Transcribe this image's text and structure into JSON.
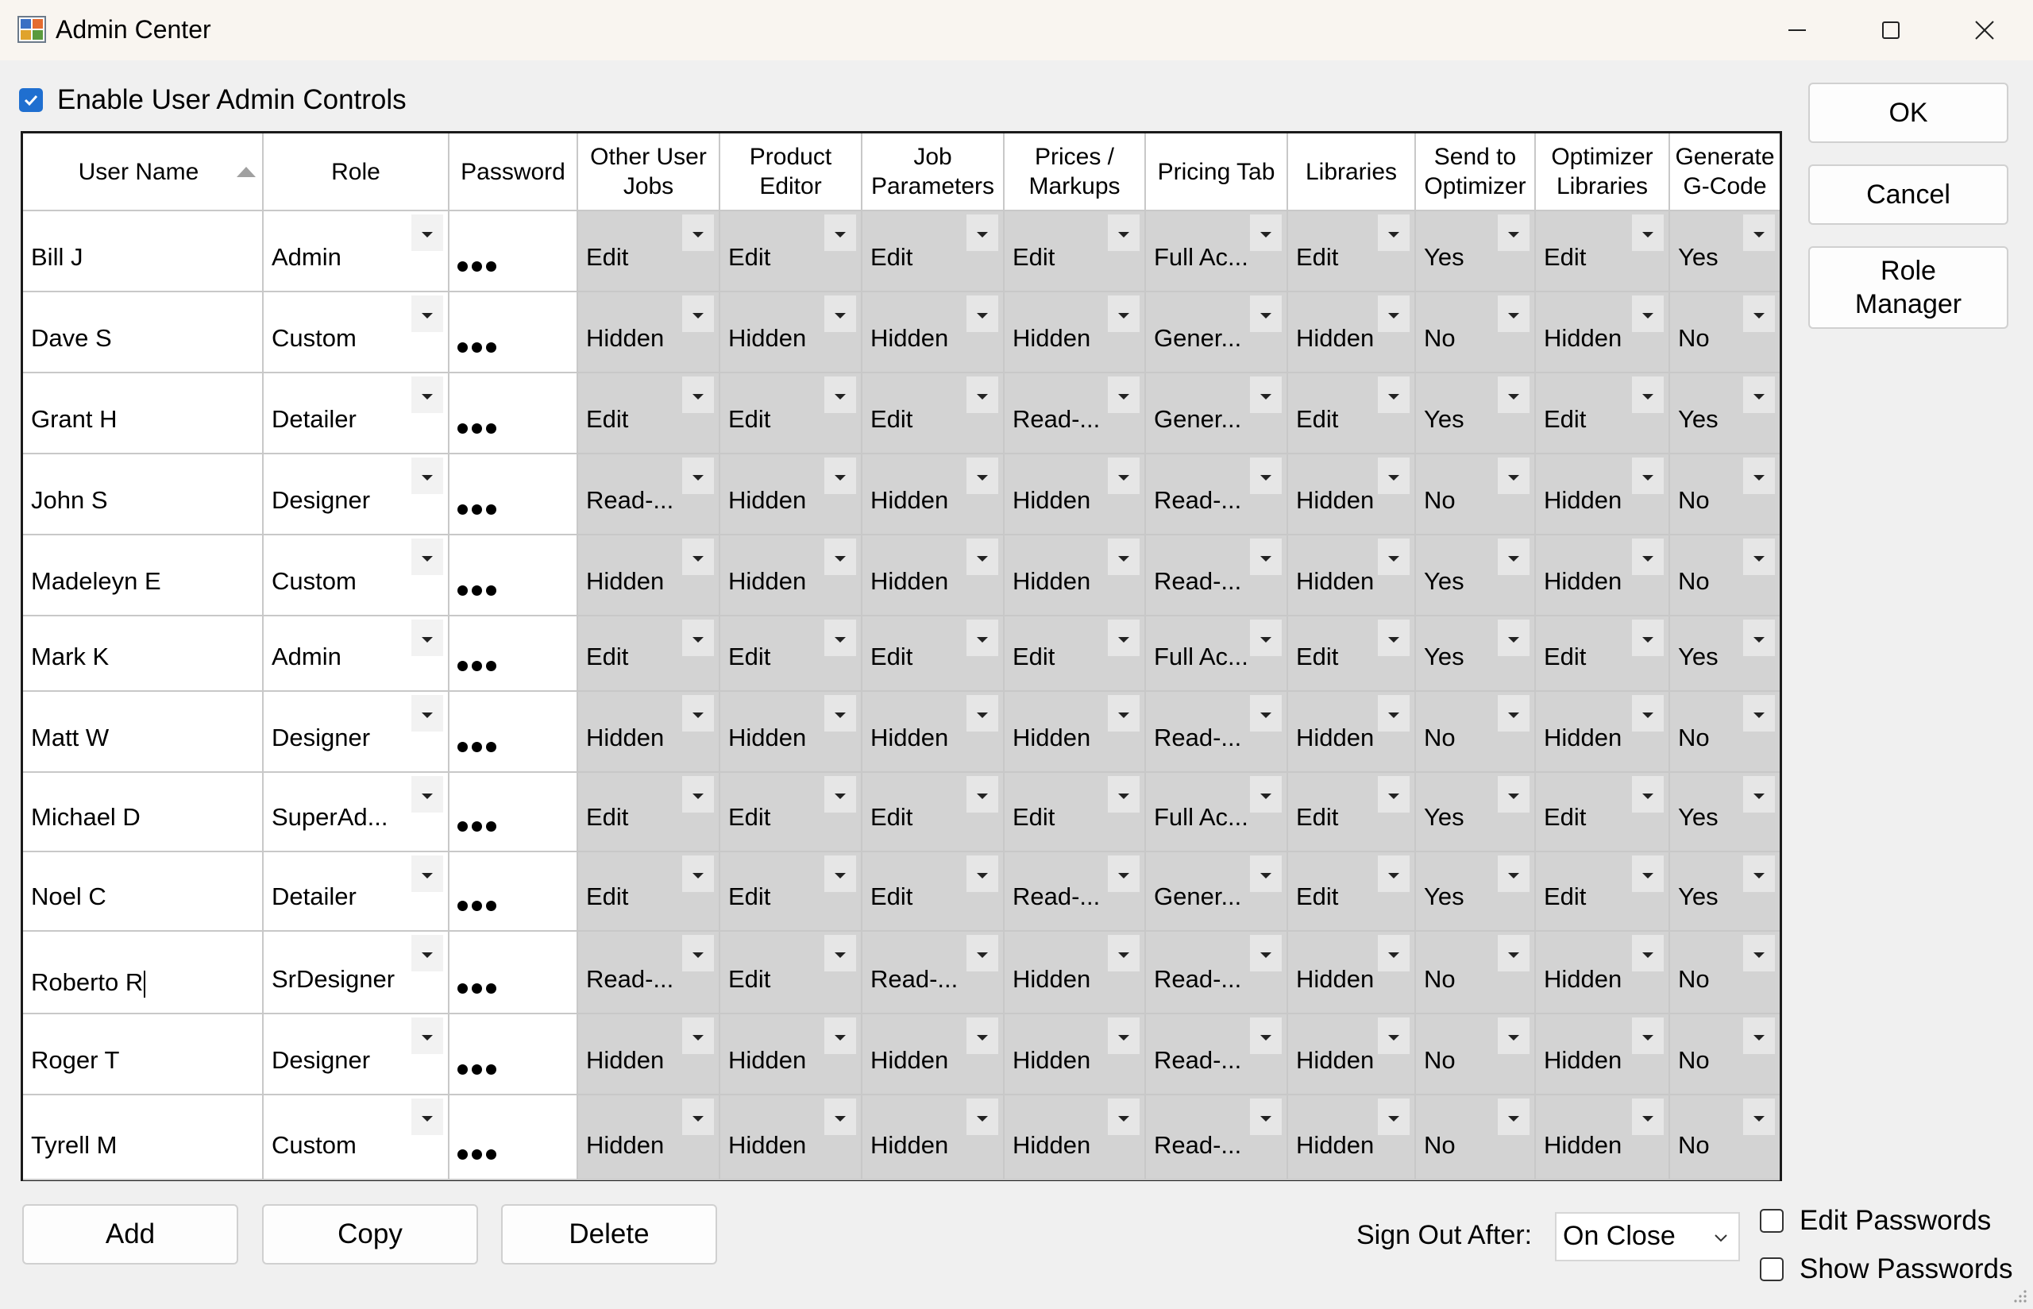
{
  "window": {
    "title": "Admin Center"
  },
  "enable_controls": {
    "label": "Enable User Admin Controls",
    "checked": true
  },
  "grid": {
    "columns": [
      {
        "key": "user",
        "label": "User Name",
        "sort": "ascending"
      },
      {
        "key": "role",
        "label": "Role"
      },
      {
        "key": "password",
        "label": "Password"
      },
      {
        "key": "other_jobs",
        "label": "Other User Jobs"
      },
      {
        "key": "product_editor",
        "label": "Product Editor"
      },
      {
        "key": "job_params",
        "label": "Job Parameters"
      },
      {
        "key": "prices",
        "label": "Prices / Markups"
      },
      {
        "key": "pricing_tab",
        "label": "Pricing Tab"
      },
      {
        "key": "libraries",
        "label": "Libraries"
      },
      {
        "key": "send_opt",
        "label": "Send to Optimizer"
      },
      {
        "key": "opt_libs",
        "label": "Optimizer Libraries"
      },
      {
        "key": "gcode",
        "label": "Generate G-Code"
      }
    ],
    "rows": [
      {
        "user": "Bill J",
        "role": "Admin",
        "password": "•••",
        "other_jobs": "Edit",
        "product_editor": "Edit",
        "job_params": "Edit",
        "prices": "Edit",
        "pricing_tab": "Full Ac...",
        "libraries": "Edit",
        "send_opt": "Yes",
        "opt_libs": "Edit",
        "gcode": "Yes"
      },
      {
        "user": "Dave S",
        "role": "Custom",
        "password": "•••",
        "other_jobs": "Hidden",
        "product_editor": "Hidden",
        "job_params": "Hidden",
        "prices": "Hidden",
        "pricing_tab": "Gener...",
        "libraries": "Hidden",
        "send_opt": "No",
        "opt_libs": "Hidden",
        "gcode": "No"
      },
      {
        "user": "Grant H",
        "role": "Detailer",
        "password": "•••",
        "other_jobs": "Edit",
        "product_editor": "Edit",
        "job_params": "Edit",
        "prices": "Read-...",
        "pricing_tab": "Gener...",
        "libraries": "Edit",
        "send_opt": "Yes",
        "opt_libs": "Edit",
        "gcode": "Yes"
      },
      {
        "user": "John S",
        "role": "Designer",
        "password": "•••",
        "other_jobs": "Read-...",
        "product_editor": "Hidden",
        "job_params": "Hidden",
        "prices": "Hidden",
        "pricing_tab": "Read-...",
        "libraries": "Hidden",
        "send_opt": "No",
        "opt_libs": "Hidden",
        "gcode": "No"
      },
      {
        "user": "Madeleyn E",
        "role": "Custom",
        "password": "•••",
        "other_jobs": "Hidden",
        "product_editor": "Hidden",
        "job_params": "Hidden",
        "prices": "Hidden",
        "pricing_tab": "Read-...",
        "libraries": "Hidden",
        "send_opt": "Yes",
        "opt_libs": "Hidden",
        "gcode": "No"
      },
      {
        "user": "Mark K",
        "role": "Admin",
        "password": "•••",
        "other_jobs": "Edit",
        "product_editor": "Edit",
        "job_params": "Edit",
        "prices": "Edit",
        "pricing_tab": "Full Ac...",
        "libraries": "Edit",
        "send_opt": "Yes",
        "opt_libs": "Edit",
        "gcode": "Yes"
      },
      {
        "user": "Matt W",
        "role": "Designer",
        "password": "•••",
        "other_jobs": "Hidden",
        "product_editor": "Hidden",
        "job_params": "Hidden",
        "prices": "Hidden",
        "pricing_tab": "Read-...",
        "libraries": "Hidden",
        "send_opt": "No",
        "opt_libs": "Hidden",
        "gcode": "No"
      },
      {
        "user": "Michael D",
        "role": "SuperAd...",
        "password": "•••",
        "other_jobs": "Edit",
        "product_editor": "Edit",
        "job_params": "Edit",
        "prices": "Edit",
        "pricing_tab": "Full Ac...",
        "libraries": "Edit",
        "send_opt": "Yes",
        "opt_libs": "Edit",
        "gcode": "Yes"
      },
      {
        "user": "Noel C",
        "role": "Detailer",
        "password": "•••",
        "other_jobs": "Edit",
        "product_editor": "Edit",
        "job_params": "Edit",
        "prices": "Read-...",
        "pricing_tab": "Gener...",
        "libraries": "Edit",
        "send_opt": "Yes",
        "opt_libs": "Edit",
        "gcode": "Yes"
      },
      {
        "user": "Roberto R",
        "role": "SrDesigner",
        "password": "•••",
        "other_jobs": "Read-...",
        "product_editor": "Edit",
        "job_params": "Read-...",
        "prices": "Hidden",
        "pricing_tab": "Read-...",
        "libraries": "Hidden",
        "send_opt": "No",
        "opt_libs": "Hidden",
        "gcode": "No",
        "editing": true
      },
      {
        "user": "Roger T",
        "role": "Designer",
        "password": "•••",
        "other_jobs": "Hidden",
        "product_editor": "Hidden",
        "job_params": "Hidden",
        "prices": "Hidden",
        "pricing_tab": "Read-...",
        "libraries": "Hidden",
        "send_opt": "No",
        "opt_libs": "Hidden",
        "gcode": "No"
      },
      {
        "user": "Tyrell M",
        "role": "Custom",
        "password": "•••",
        "other_jobs": "Hidden",
        "product_editor": "Hidden",
        "job_params": "Hidden",
        "prices": "Hidden",
        "pricing_tab": "Read-...",
        "libraries": "Hidden",
        "send_opt": "No",
        "opt_libs": "Hidden",
        "gcode": "No"
      }
    ]
  },
  "buttons": {
    "ok": "OK",
    "cancel": "Cancel",
    "role_manager": "Role Manager",
    "add": "Add",
    "copy": "Copy",
    "delete": "Delete"
  },
  "sign_out": {
    "label": "Sign Out After:",
    "value": "On Close"
  },
  "options": {
    "edit_passwords": "Edit Passwords",
    "show_passwords": "Show Passwords"
  },
  "icons": {
    "app": "admin-center-app-icon",
    "minimize": "minimize-icon",
    "maximize": "maximize-icon",
    "close": "close-icon",
    "dropdown": "chevron-down-icon",
    "sort": "sort-ascending-icon"
  },
  "colors": {
    "checkbox_accent": "#1f6fd0",
    "permission_cell": "#d3d3d3"
  }
}
